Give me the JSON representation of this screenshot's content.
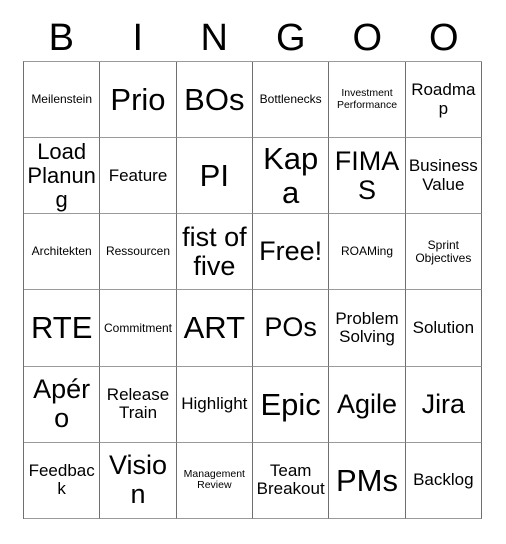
{
  "card": {
    "header_letters": [
      "B",
      "I",
      "N",
      "G",
      "O",
      "O"
    ],
    "rows": [
      [
        {
          "text": "Meilenstein",
          "size": "s"
        },
        {
          "text": "Prio",
          "size": "xxl"
        },
        {
          "text": "BOs",
          "size": "xxl"
        },
        {
          "text": "Bottlenecks",
          "size": "s"
        },
        {
          "text": "Investment Performance",
          "size": "xs"
        },
        {
          "text": "Roadmap",
          "size": "m"
        }
      ],
      [
        {
          "text": "Load Planung",
          "size": "l"
        },
        {
          "text": "Feature",
          "size": "m"
        },
        {
          "text": "PI",
          "size": "xxl"
        },
        {
          "text": "Kapa",
          "size": "xxl"
        },
        {
          "text": "FIMAS",
          "size": "xl"
        },
        {
          "text": "Business Value",
          "size": "m"
        }
      ],
      [
        {
          "text": "Architekten",
          "size": "s"
        },
        {
          "text": "Ressourcen",
          "size": "s"
        },
        {
          "text": "fist of five",
          "size": "xl"
        },
        {
          "text": "Free!",
          "size": "xl"
        },
        {
          "text": "ROAMing",
          "size": "s"
        },
        {
          "text": "Sprint Objectives",
          "size": "s"
        }
      ],
      [
        {
          "text": "RTE",
          "size": "xxl"
        },
        {
          "text": "Commitment",
          "size": "s"
        },
        {
          "text": "ART",
          "size": "xxl"
        },
        {
          "text": "POs",
          "size": "xl"
        },
        {
          "text": "Problem Solving",
          "size": "m"
        },
        {
          "text": "Solution",
          "size": "m"
        }
      ],
      [
        {
          "text": "Apéro",
          "size": "xl"
        },
        {
          "text": "Release Train",
          "size": "m"
        },
        {
          "text": "Highlight",
          "size": "m"
        },
        {
          "text": "Epic",
          "size": "xxl"
        },
        {
          "text": "Agile",
          "size": "xl"
        },
        {
          "text": "Jira",
          "size": "xl"
        }
      ],
      [
        {
          "text": "Feedback",
          "size": "m"
        },
        {
          "text": "Vision",
          "size": "xl"
        },
        {
          "text": "Management Review",
          "size": "xs"
        },
        {
          "text": "Team Breakout",
          "size": "m"
        },
        {
          "text": "PMs",
          "size": "xxl"
        },
        {
          "text": "Backlog",
          "size": "m"
        }
      ]
    ]
  },
  "colors": {
    "background": "#ffffff",
    "text": "#000000",
    "border_vertical": "#6f6f6f",
    "border_horizontal": "#9a9a9a"
  }
}
